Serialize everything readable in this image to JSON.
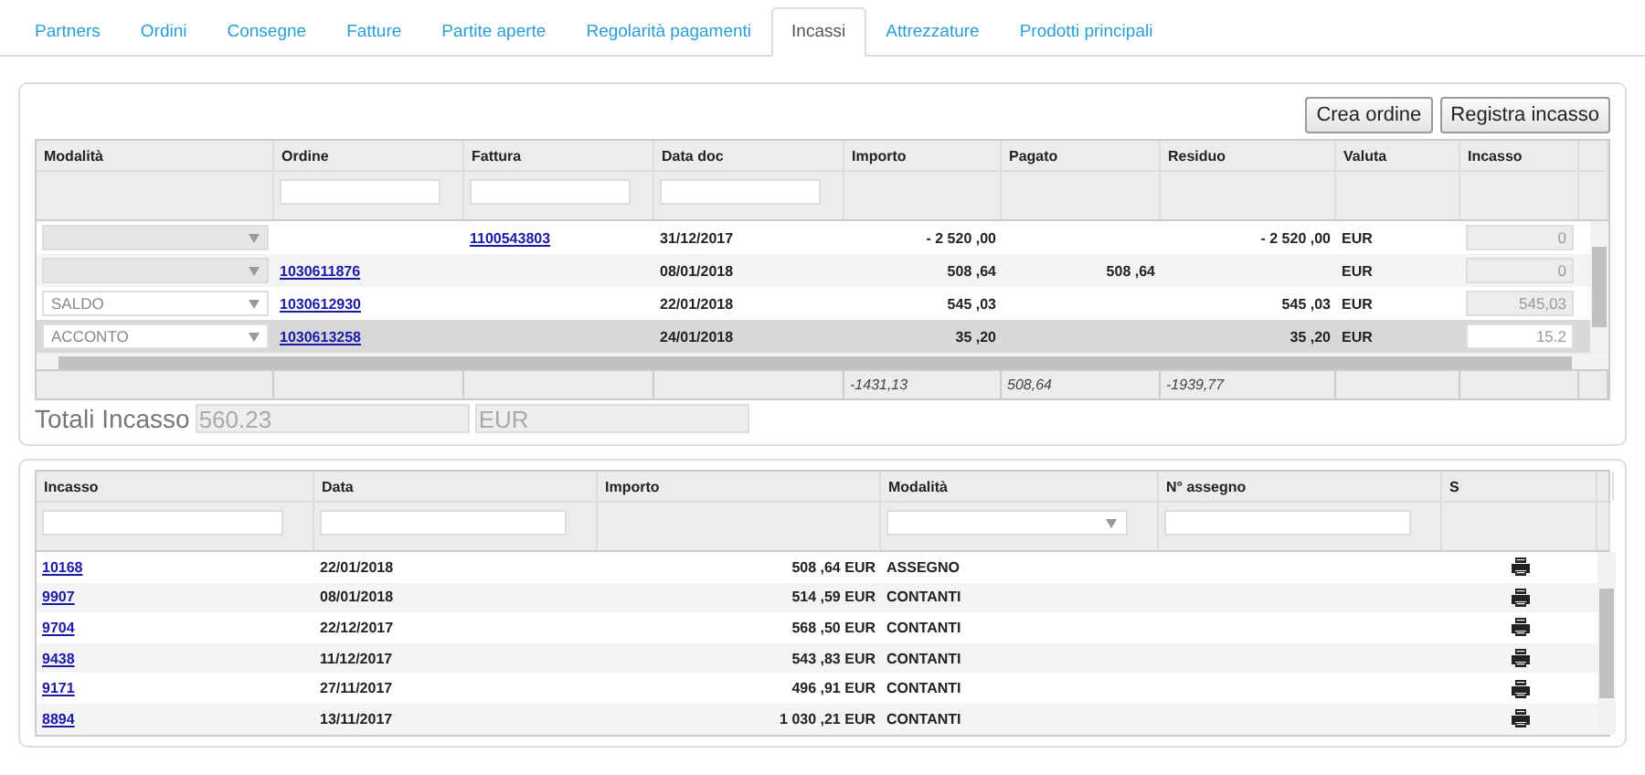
{
  "tabs": [
    {
      "label": "Partners",
      "selected": false
    },
    {
      "label": "Ordini",
      "selected": false
    },
    {
      "label": "Consegne",
      "selected": false
    },
    {
      "label": "Fatture",
      "selected": false
    },
    {
      "label": "Partite aperte",
      "selected": false
    },
    {
      "label": "Regolarità pagamenti",
      "selected": false
    },
    {
      "label": "Incassi",
      "selected": true
    },
    {
      "label": "Attrezzature",
      "selected": false
    },
    {
      "label": "Prodotti principali",
      "selected": false
    }
  ],
  "actions": [
    "Crea ordine",
    "Registra incasso"
  ],
  "orders_table": {
    "columns": [
      {
        "label": "Modalità",
        "kind": "plain"
      },
      {
        "label": "Ordine",
        "kind": "text"
      },
      {
        "label": "Fattura",
        "kind": "text"
      },
      {
        "label": "Data doc",
        "kind": "text"
      },
      {
        "label": "Importo",
        "kind": "plain"
      },
      {
        "label": "Pagato",
        "kind": "plain"
      },
      {
        "label": "Residuo",
        "kind": "plain"
      },
      {
        "label": "Valuta",
        "kind": "plain"
      },
      {
        "label": "Incasso",
        "kind": "plain"
      }
    ],
    "rows": [
      {
        "modalita_disabled": true,
        "fattura": "1100543803",
        "data_doc": "31/12/2017",
        "importo": "- 2 520 ,00",
        "residuo": "- 2 520 ,00",
        "valuta": "EUR",
        "incasso": "0",
        "incasso_disabled": true,
        "selected": false
      },
      {
        "modalita_disabled": true,
        "ordine": "1030611876",
        "data_doc": "08/01/2018",
        "importo": "508 ,64",
        "pagato": "508 ,64",
        "valuta": "EUR",
        "incasso": "0",
        "incasso_disabled": true,
        "selected": false
      },
      {
        "modalita": "SALDO",
        "modalita_disabled": false,
        "ordine": "1030612930",
        "data_doc": "22/01/2018",
        "importo": "545 ,03",
        "residuo": "545 ,03",
        "valuta": "EUR",
        "incasso": "545,03",
        "incasso_disabled": true,
        "selected": false
      },
      {
        "modalita": "ACCONTO",
        "modalita_disabled": false,
        "ordine": "1030613258",
        "data_doc": "24/01/2018",
        "importo": "35 ,20",
        "residuo": "35 ,20",
        "valuta": "EUR",
        "incasso": "15.2",
        "incasso_disabled": false,
        "selected": true
      }
    ],
    "totals": {
      "importo": "-1431,13",
      "pagato": "508,64",
      "residuo": "-1939,77"
    }
  },
  "totali": {
    "label": "Totali Incasso",
    "amount": "560.23",
    "currency": "EUR"
  },
  "receipts_table": {
    "columns": [
      {
        "label": "Incasso",
        "kind": "text"
      },
      {
        "label": "Data",
        "kind": "text"
      },
      {
        "label": "Importo",
        "kind": "plain"
      },
      {
        "label": "Modalità",
        "kind": "select"
      },
      {
        "label": "N° assegno",
        "kind": "text"
      },
      {
        "label": "S",
        "kind": "plain"
      }
    ],
    "rows": [
      {
        "incasso": "10168",
        "data": "22/01/2018",
        "importo": "508 ,64 EUR",
        "modalita": "ASSEGNO"
      },
      {
        "incasso": "9907",
        "data": "08/01/2018",
        "importo": "514 ,59 EUR",
        "modalita": "CONTANTI"
      },
      {
        "incasso": "9704",
        "data": "22/12/2017",
        "importo": "568 ,50 EUR",
        "modalita": "CONTANTI"
      },
      {
        "incasso": "9438",
        "data": "11/12/2017",
        "importo": "543 ,83 EUR",
        "modalita": "CONTANTI"
      },
      {
        "incasso": "9171",
        "data": "27/11/2017",
        "importo": "496 ,91 EUR",
        "modalita": "CONTANTI"
      },
      {
        "incasso": "8894",
        "data": "13/11/2017",
        "importo": "1 030 ,21 EUR",
        "modalita": "CONTANTI"
      }
    ]
  }
}
